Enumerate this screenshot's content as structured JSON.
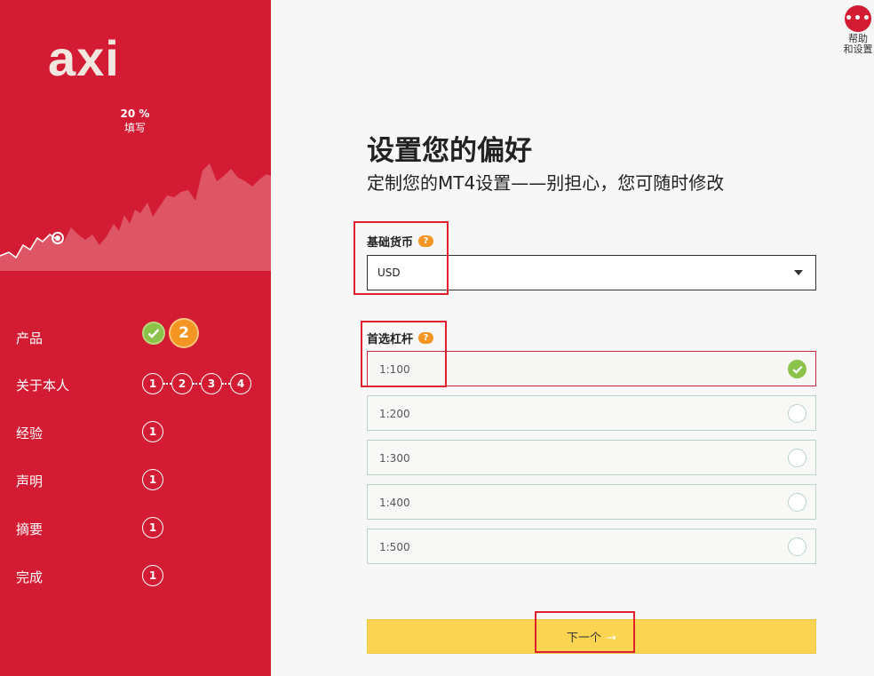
{
  "brand": {
    "logo_text": "axi",
    "color": "#d31c33"
  },
  "progress": {
    "percent": "20 %",
    "label": "填写"
  },
  "steps": [
    {
      "label": "产品"
    },
    {
      "label": "关于本人",
      "dots": [
        "1",
        "2",
        "3",
        "4"
      ]
    },
    {
      "label": "经验",
      "dots": [
        "1"
      ]
    },
    {
      "label": "声明",
      "dots": [
        "1"
      ]
    },
    {
      "label": "摘要",
      "dots": [
        "1"
      ]
    },
    {
      "label": "完成",
      "dots": [
        "1"
      ]
    }
  ],
  "product_step": {
    "active_number": "2"
  },
  "help": {
    "icon": "more-icon",
    "line1": "帮助",
    "line2": "和设置"
  },
  "page": {
    "title": "设置您的偏好",
    "subtitle": "定制您的MT4设置——别担心，您可随时修改"
  },
  "currency": {
    "label": "基础货币",
    "help": "?",
    "value": "USD"
  },
  "leverage": {
    "label": "首选杠杆",
    "help": "?",
    "options": [
      {
        "value": "1:100",
        "selected": true
      },
      {
        "value": "1:200",
        "selected": false
      },
      {
        "value": "1:300",
        "selected": false
      },
      {
        "value": "1:400",
        "selected": false
      },
      {
        "value": "1:500",
        "selected": false
      }
    ]
  },
  "next_button": {
    "label": "下一个",
    "arrow": "→"
  },
  "colors": {
    "accent_yellow": "#fbd552",
    "success_green": "#8bc34a",
    "step_orange": "#f39423"
  }
}
